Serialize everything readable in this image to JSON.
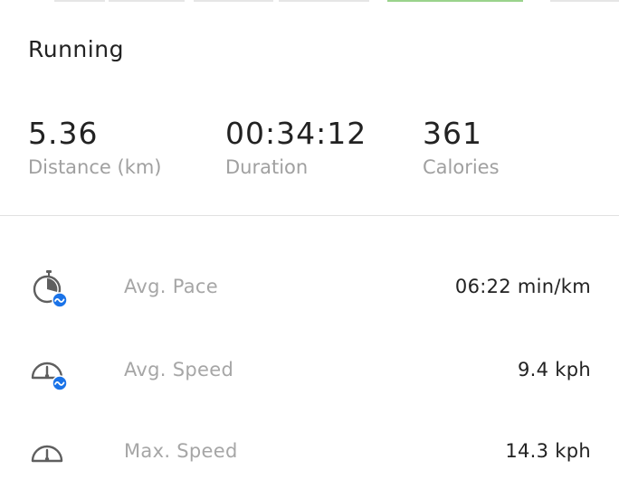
{
  "activity": {
    "title": "Running"
  },
  "stats": {
    "distance": {
      "value": "5.36",
      "label": "Distance (km)"
    },
    "duration": {
      "value": "00:34:12",
      "label": "Duration"
    },
    "calories": {
      "value": "361",
      "label": "Calories"
    }
  },
  "metrics": [
    {
      "label": "Avg. Pace",
      "value": "06:22 min/km",
      "icon": "pace-stopwatch-icon"
    },
    {
      "label": "Avg. Speed",
      "value": "9.4 kph",
      "icon": "avg-speed-gauge-icon"
    },
    {
      "label": "Max. Speed",
      "value": "14.3 kph",
      "icon": "max-speed-gauge-icon"
    }
  ],
  "colors": {
    "accent_blue": "#1a73e8",
    "icon_gray": "#5f5f5f",
    "tab_active": "#9ad38c"
  }
}
